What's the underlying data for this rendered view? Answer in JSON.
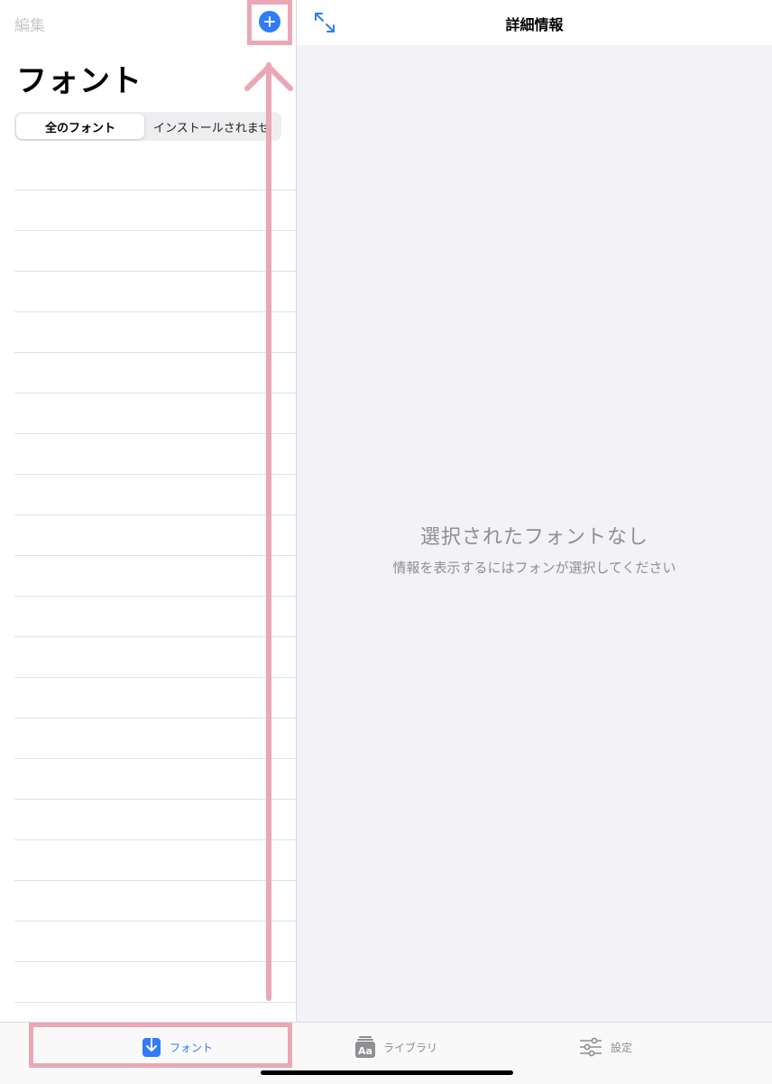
{
  "sidebar": {
    "edit_label": "編集",
    "title": "フォント",
    "segments": [
      "全のフォント",
      "インストールされませ"
    ],
    "add_icon": "plus-circle-icon"
  },
  "detail": {
    "title": "詳細情報",
    "expand_icon": "expand-arrows-icon",
    "empty_title": "選択されたフォントなし",
    "empty_subtitle": "情報を表示するにはフォンが選択してください"
  },
  "tabbar": {
    "tabs": [
      {
        "label": "フォント",
        "icon": "download-icon",
        "selected": true
      },
      {
        "label": "ライブラリ",
        "icon": "library-aa-icon",
        "selected": false
      },
      {
        "label": "設定",
        "icon": "sliders-icon",
        "selected": false
      }
    ]
  },
  "colors": {
    "accent": "#2f7cf6",
    "secondary_text": "#8e8e93",
    "detail_background": "#f2f2f7",
    "annotation": "#eba7b5"
  }
}
